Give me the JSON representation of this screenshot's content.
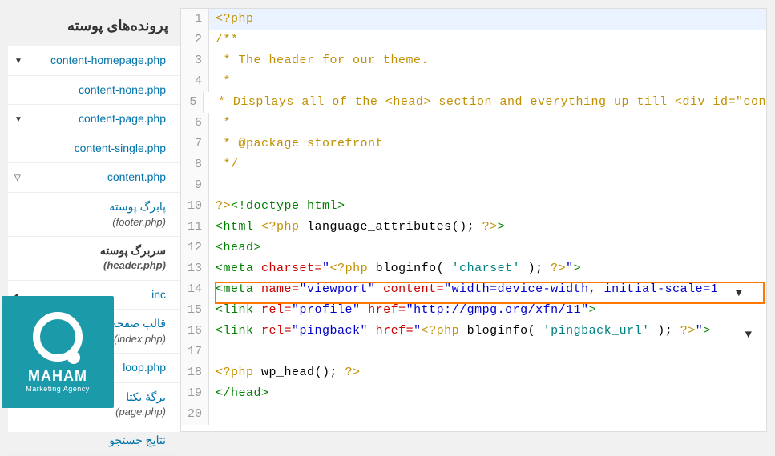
{
  "sidebar": {
    "header": "پرونده‌های پوسته",
    "files": [
      {
        "label": "content-homepage.php",
        "en": "",
        "chev": "▼"
      },
      {
        "label": "content-none.php",
        "en": ""
      },
      {
        "label": "content-page.php",
        "en": "",
        "chev": "▼"
      },
      {
        "label": "content-single.php",
        "en": ""
      },
      {
        "label": "content.php",
        "en": "",
        "chev": "▽"
      },
      {
        "label": "پابرگ پوسته",
        "en": "(footer.php)"
      },
      {
        "label": "سربرگ پوسته",
        "en": "(header.php)",
        "active": true
      },
      {
        "label": "inc",
        "en": "",
        "folder": true,
        "chev": "◂"
      },
      {
        "label": "قالب صفحه اصلی",
        "en": "(index.php)"
      },
      {
        "label": "loop.php",
        "en": ""
      },
      {
        "label": "برگهٔ یکتا",
        "en": "(page.php)"
      },
      {
        "label": "نتایج جستجو",
        "en": ""
      }
    ]
  },
  "code": {
    "lines": [
      {
        "n": 1,
        "hl": true,
        "html": "<span class='t-php'>&lt;?php</span>"
      },
      {
        "n": 2,
        "html": "<span class='t-cmt'>/**</span>"
      },
      {
        "n": 3,
        "html": "<span class='t-cmt'> * The header for our theme.</span>"
      },
      {
        "n": 4,
        "html": "<span class='t-cmt'> *</span>"
      },
      {
        "n": 5,
        "html": "<span class='t-cmt'> * Displays all of the &lt;head&gt; section and everything up till &lt;div id=\"con</span>"
      },
      {
        "n": 6,
        "html": "<span class='t-cmt'> *</span>"
      },
      {
        "n": 7,
        "html": "<span class='t-cmt'> * @package storefront</span>"
      },
      {
        "n": 8,
        "html": "<span class='t-cmt'> */</span>"
      },
      {
        "n": 9,
        "html": ""
      },
      {
        "n": 10,
        "html": "<span class='t-php'>?&gt;</span><span class='t-tag'>&lt;!doctype html&gt;</span>"
      },
      {
        "n": 11,
        "html": "<span class='t-tag'>&lt;html</span> <span class='t-php'>&lt;?php</span> language_attributes(); <span class='t-php'>?&gt;</span><span class='t-tag'>&gt;</span>"
      },
      {
        "n": 12,
        "html": "<span class='t-tag'>&lt;head&gt;</span>"
      },
      {
        "n": 13,
        "html": "<span class='t-tag'>&lt;meta</span> <span class='t-attr'>charset=</span><span class='t-val'>\"</span><span class='t-php'>&lt;?php</span> bloginfo( <span class='t-str'>'charset'</span> ); <span class='t-php'>?&gt;</span><span class='t-val'>\"</span><span class='t-tag'>&gt;</span>"
      },
      {
        "n": 14,
        "html": "<span class='t-tag'>&lt;meta</span> <span class='t-attr'>name=</span><span class='t-val'>\"viewport\"</span> <span class='t-attr'>content=</span><span class='t-val'>\"width=device-width, initial-scale=1</span>"
      },
      {
        "n": 15,
        "html": "<span class='t-tag'>&lt;link</span> <span class='t-attr'>rel=</span><span class='t-val'>\"profile\"</span> <span class='t-attr'>href=</span><span class='t-val'>\"http://gmpg.org/xfn/11\"</span><span class='t-tag'>&gt;</span>"
      },
      {
        "n": 16,
        "html": "<span class='t-tag'>&lt;link</span> <span class='t-attr'>rel=</span><span class='t-val'>\"pingback\"</span> <span class='t-attr'>href=</span><span class='t-val'>\"</span><span class='t-php'>&lt;?php</span> bloginfo( <span class='t-str'>'pingback_url'</span> ); <span class='t-php'>?&gt;</span><span class='t-val'>\"</span><span class='t-tag'>&gt;</span>"
      },
      {
        "n": 17,
        "html": ""
      },
      {
        "n": 18,
        "html": "<span class='t-php'>&lt;?php</span> wp_head(); <span class='t-php'>?&gt;</span>"
      },
      {
        "n": 19,
        "html": "<span class='t-tag'>&lt;/head&gt;</span>"
      },
      {
        "n": 20,
        "html": ""
      }
    ]
  },
  "logo": {
    "name": "MAHAM",
    "tag": "Marketing Agency"
  }
}
